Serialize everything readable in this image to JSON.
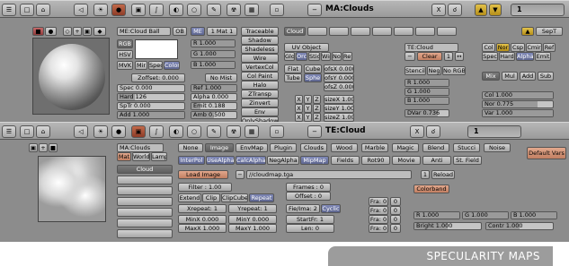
{
  "top_header": {
    "name_field": "MA:Clouds",
    "right_number": "1",
    "close_x": "X"
  },
  "mid_header": {
    "name_field": "TE:Cloud",
    "right_number": "1",
    "close_x": "X"
  },
  "caption": "SPECULARITY MAPS",
  "material": {
    "preview_tabs": [
      "■",
      "●",
      "▣"
    ],
    "name_field": "ME:Cloud Ball",
    "ob_btn": "OB",
    "me_btn": "ME",
    "mat_count": "1 Mat 1",
    "color_modes": [
      "RGB",
      "HSV",
      "MVK"
    ],
    "mir_btn": "Mir",
    "spec_btn": "Spec",
    "color_btn": "Color",
    "zoffset": "Zoffset: 0.000",
    "rgb": [
      "R 1.000",
      "G 1.000",
      "B 1.000"
    ],
    "no_mist": "No Mist",
    "spec": "Spec 0.000",
    "hard": "Hard 126",
    "sptr": "SpTr 0.000",
    "add": "Add 1.000",
    "ref": "Ref 1.000",
    "alpha": "Alpha 0.000",
    "emit": "Emit 0.188",
    "amb": "Amb 0.500",
    "flags": [
      "Traceable",
      "Shadow",
      "Shadeless",
      "Wire",
      "VertexCol",
      "Col Paint",
      "Halo",
      "ZTransp",
      "Zinvert",
      "Env",
      "OnlyShadow"
    ]
  },
  "tex_channel": {
    "name": "Cloud",
    "uv_object": "UV Object",
    "mapping": [
      "Glob",
      "Orco",
      "Stick",
      "Win",
      "Nor",
      "Refl"
    ],
    "proj": [
      "Flat",
      "Cube",
      "Tube",
      "Sphe"
    ],
    "xyz_rows": [
      [
        "X",
        "Y",
        "Z"
      ],
      [
        "X",
        "Y",
        "Z"
      ],
      [
        "X",
        "Y",
        "Z"
      ]
    ],
    "ofs": [
      "ofsX 0.000",
      "ofsY 0.000",
      "ofsZ 0.000"
    ],
    "size": [
      "sizeX 1.00",
      "sizeY 1.00",
      "sizeZ 1.00"
    ],
    "tex_field": "TE:Cloud",
    "clear": "Clear",
    "clear_num": "1",
    "stencil": "Stencil",
    "neg": "Neg",
    "no_rgb": "No RGB",
    "rgb": [
      "R 1.000",
      "G 1.000",
      "B 1.000"
    ],
    "dvar": "DVar 0.736",
    "top_toggles": [
      "Col",
      "Nor",
      "Csp",
      "Cmir",
      "Ref"
    ],
    "second_toggles": [
      "Spec",
      "Hard",
      "Alpha",
      "Emit"
    ],
    "blend": [
      "Mix",
      "Mul",
      "Add",
      "Sub"
    ],
    "col": "Col 1.000",
    "nor": "Nor 0.775",
    "var": "Var 1.000",
    "sept": "SepT"
  },
  "texture": {
    "tabs": [
      "▣",
      "+",
      "■"
    ],
    "ma_name": "MA:Clouds",
    "world_btns": [
      "Mat",
      "World",
      "Lamp"
    ],
    "slot_name": "Cloud",
    "type_btns": [
      "None",
      "Image",
      "EnvMap",
      "Plugin",
      "Clouds",
      "Wood",
      "Marble",
      "Magic",
      "Blend",
      "Stucci",
      "Noise"
    ],
    "default_vars": "Default Vars",
    "img_btns": [
      "InterPol",
      "UseAlpha",
      "CalcAlpha",
      "NegAlpha",
      "MipMap",
      "Fields",
      "Rot90",
      "Movie",
      "Anti",
      "St. Field"
    ],
    "load_image": "Load Image",
    "path": "//cloudmap.tga",
    "reload_num": "1",
    "reload": "Reload",
    "filter": "Filter : 1.00",
    "frames": "Frames : 0",
    "offset": "Offset : 0",
    "extend_btns": [
      "Extend",
      "Clip",
      "ClipCube",
      "Repeat"
    ],
    "colorband": "Colorband",
    "xrepeat": "Xrepeat: 1",
    "yrepeat": "Yrepeat: 1",
    "fie_ima": "Fie/Ima: 2",
    "cyclic": "Cyclic",
    "minx": "MinX 0.000",
    "miny": "MinY 0.000",
    "startfr": "StartFr: 1",
    "maxx": "MaxX 1.000",
    "maxy": "MaxY 1.000",
    "len": "Len: 0",
    "fra": [
      "Fra: 0",
      "Fra: 0",
      "Fra: 0",
      "Fra: 0"
    ],
    "fra_right": [
      "0",
      "0",
      "0",
      "0"
    ],
    "r": "R 1.000",
    "g": "G 1.000",
    "b": "B 1.000",
    "bright": "Bright 1.000",
    "contr": "Contr 1.000"
  }
}
